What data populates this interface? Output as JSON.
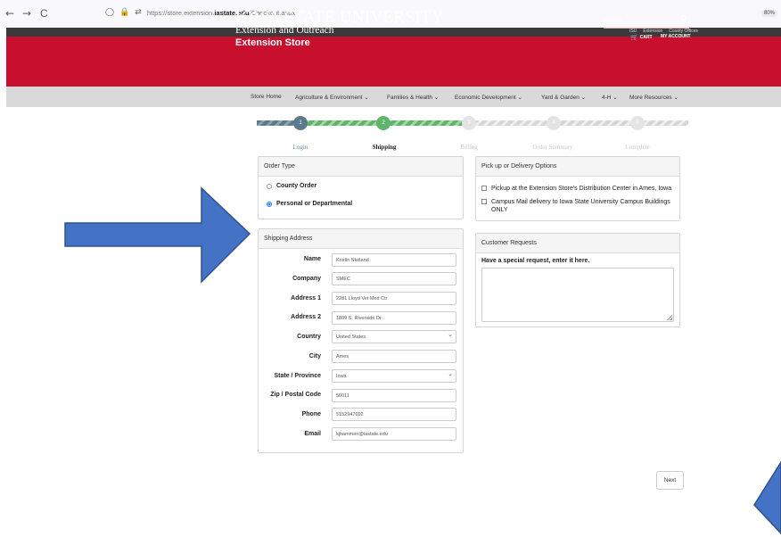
{
  "browser": {
    "back": "←",
    "forward": "→",
    "reload": "C",
    "url_prefix": "https://store.extension.",
    "url_host": "iastate.edu",
    "url_path": "/Checkout.aspx",
    "zoom": "80%"
  },
  "utility_links": [
    "ISU",
    "Extension",
    "County Offices"
  ],
  "header": {
    "wordmark": "IOWA STATE UNIVERSITY",
    "sub": "Extension and Outreach",
    "store": "Extension Store",
    "search_label": "Search",
    "cart": "CART",
    "account": "MY ACCOUNT"
  },
  "nav": {
    "items": [
      "Store Home",
      "Agriculture & Environment ⌄",
      "Families & Health ⌄",
      "Economic Development ⌄",
      "Yard & Garden ⌄",
      "4-H ⌄",
      "More Resources ⌄"
    ]
  },
  "steps": [
    {
      "num": "1",
      "label": "Login"
    },
    {
      "num": "2",
      "label": "Shipping"
    },
    {
      "num": "3",
      "label": "Billing"
    },
    {
      "num": "4",
      "label": "Order Summary"
    },
    {
      "num": "5",
      "label": "Complete"
    }
  ],
  "order_type": {
    "title": "Order Type",
    "options": [
      "County Order",
      "Personal or Departmental"
    ],
    "selected_index": 1
  },
  "pickup": {
    "title": "Pick up or Delivery Options",
    "options": [
      "Pickup at the Extension Store's Distribution Center in Ames, Iowa",
      "Campus Mail delivery to Iowa State University Campus Buildings ONLY"
    ]
  },
  "shipping": {
    "title": "Shipping Address",
    "fields": [
      {
        "label": "Name",
        "value": "Kristin Skoland"
      },
      {
        "label": "Company",
        "value": "SMEC"
      },
      {
        "label": "Address 1",
        "value": "2281 Lloyd Vet Med Ctr"
      },
      {
        "label": "Address 2",
        "value": "1809 S. Riverside Dr"
      },
      {
        "label": "Country",
        "value": "United States"
      },
      {
        "label": "City",
        "value": "Ames"
      },
      {
        "label": "State / Province",
        "value": "Iowa"
      },
      {
        "label": "Zip / Postal Code",
        "value": "50011"
      },
      {
        "label": "Phone",
        "value": "5152947692"
      },
      {
        "label": "Email",
        "value": "kjhammen@iastate.edu"
      }
    ]
  },
  "customer_requests": {
    "title": "Customer Requests",
    "prompt": "Have a special request, enter it here."
  },
  "next_label": "Next",
  "colors": {
    "brand_red": "#c8102e",
    "arrow_blue": "#4472c4"
  }
}
